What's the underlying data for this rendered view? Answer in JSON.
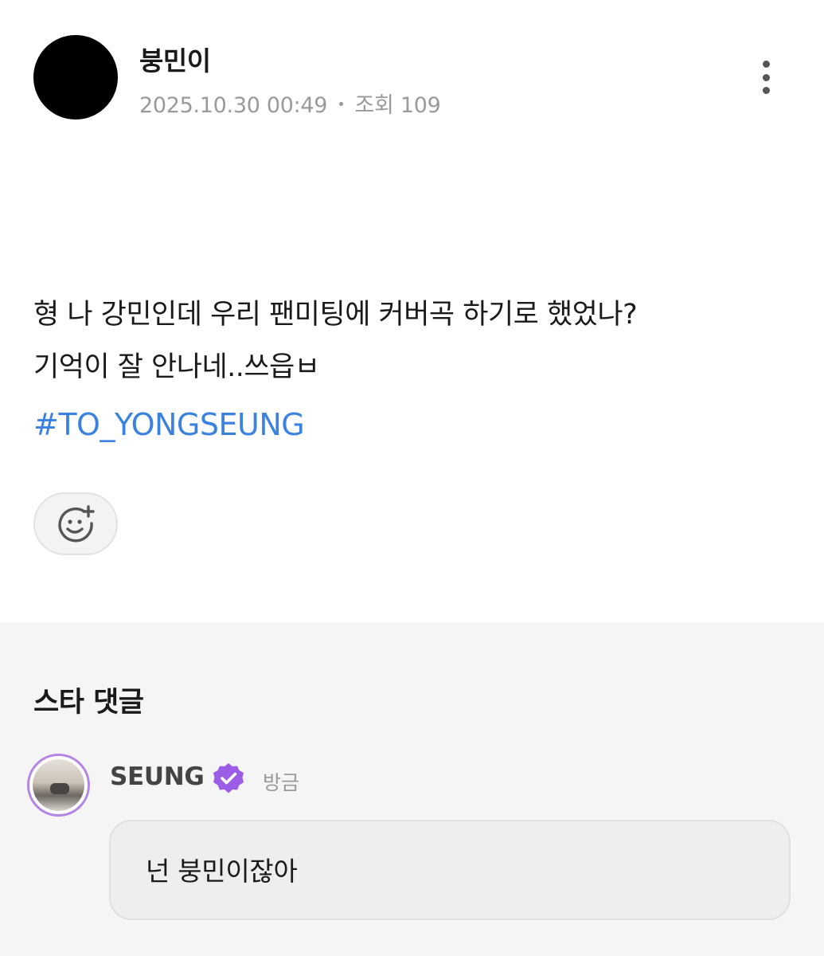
{
  "post": {
    "author": "붕민이",
    "date": "2025.10.30 00:49",
    "separator": "•",
    "views": "조회 109",
    "body_line1": "형 나 강민인데 우리 팬미팅에 커버곡 하기로 했었나?",
    "body_line2": "기억이 잘 안나네..쓰읍ㅂ",
    "hashtag": "#TO_YONGSEUNG",
    "icons": {
      "more": "more-vertical-icon",
      "reaction": "add-emoji-icon"
    }
  },
  "comments": {
    "section_title": "스타 댓글",
    "items": [
      {
        "author": "SEUNG",
        "time": "방금",
        "text": "넌 붕민이잖아",
        "verified_icon": "verified-badge-icon"
      }
    ]
  },
  "colors": {
    "hashtag": "#3b82e0",
    "verified": "#9b5de5",
    "comments_bg": "#f5f5f5",
    "meta_text": "#9a9a9a"
  }
}
